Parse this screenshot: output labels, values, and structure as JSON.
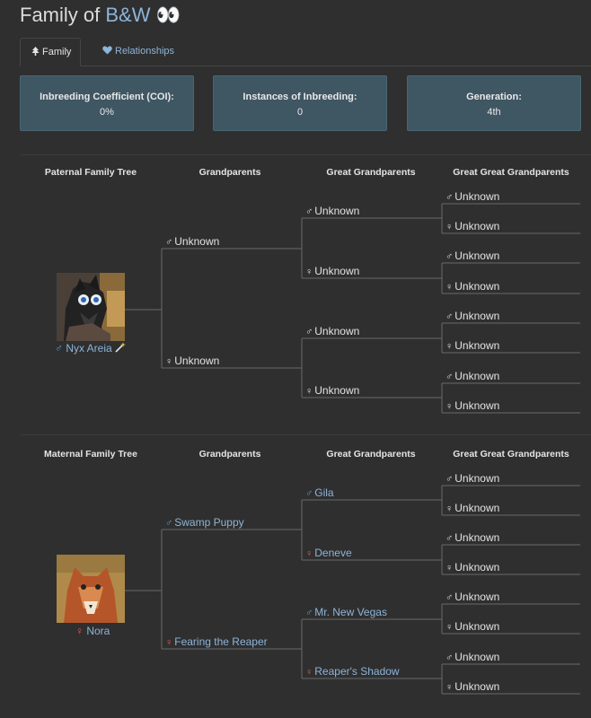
{
  "header": {
    "title_prefix": "Family of",
    "title_name": "B&W",
    "title_emoji": "👀"
  },
  "tabs": [
    {
      "label": "Family"
    },
    {
      "label": "Relationships"
    }
  ],
  "stats": [
    {
      "label": "Inbreeding Coefficient (COI):",
      "value": "0%"
    },
    {
      "label": "Instances of Inbreeding:",
      "value": "0"
    },
    {
      "label": "Generation:",
      "value": "4th"
    }
  ],
  "paternal": {
    "headers": [
      "Paternal Family Tree",
      "Grandparents",
      "Great Grandparents",
      "Great Great Grandparents"
    ],
    "parent": {
      "name": "Nyx Areia",
      "sex": "male",
      "icon": "wand-icon"
    },
    "grandparents": [
      {
        "name": "Unknown",
        "sex": "male"
      },
      {
        "name": "Unknown",
        "sex": "female"
      }
    ],
    "great_grandparents": [
      {
        "name": "Unknown",
        "sex": "male"
      },
      {
        "name": "Unknown",
        "sex": "female"
      },
      {
        "name": "Unknown",
        "sex": "male"
      },
      {
        "name": "Unknown",
        "sex": "female"
      }
    ],
    "great_great_grandparents": [
      {
        "name": "Unknown",
        "sex": "male"
      },
      {
        "name": "Unknown",
        "sex": "female"
      },
      {
        "name": "Unknown",
        "sex": "male"
      },
      {
        "name": "Unknown",
        "sex": "female"
      },
      {
        "name": "Unknown",
        "sex": "male"
      },
      {
        "name": "Unknown",
        "sex": "female"
      },
      {
        "name": "Unknown",
        "sex": "male"
      },
      {
        "name": "Unknown",
        "sex": "female"
      }
    ]
  },
  "maternal": {
    "headers": [
      "Maternal Family Tree",
      "Grandparents",
      "Great Grandparents",
      "Great Great Grandparents"
    ],
    "parent": {
      "name": "Nora",
      "sex": "female"
    },
    "grandparents": [
      {
        "name": "Swamp Puppy",
        "sex": "male"
      },
      {
        "name": "Fearing the Reaper",
        "sex": "female"
      }
    ],
    "great_grandparents": [
      {
        "name": "Gila",
        "sex": "male"
      },
      {
        "name": "Deneve",
        "sex": "female"
      },
      {
        "name": "Mr. New Vegas",
        "sex": "male"
      },
      {
        "name": "Reaper's Shadow",
        "sex": "female"
      }
    ],
    "great_great_grandparents": [
      {
        "name": "Unknown",
        "sex": "male"
      },
      {
        "name": "Unknown",
        "sex": "female"
      },
      {
        "name": "Unknown",
        "sex": "male"
      },
      {
        "name": "Unknown",
        "sex": "female"
      },
      {
        "name": "Unknown",
        "sex": "male"
      },
      {
        "name": "Unknown",
        "sex": "female"
      },
      {
        "name": "Unknown",
        "sex": "male"
      },
      {
        "name": "Unknown",
        "sex": "female"
      }
    ]
  },
  "colors": {
    "male": "#5a9fd4",
    "female": "#e05a5a",
    "link": "#8db4d9",
    "stat_bg": "#3f5663"
  }
}
